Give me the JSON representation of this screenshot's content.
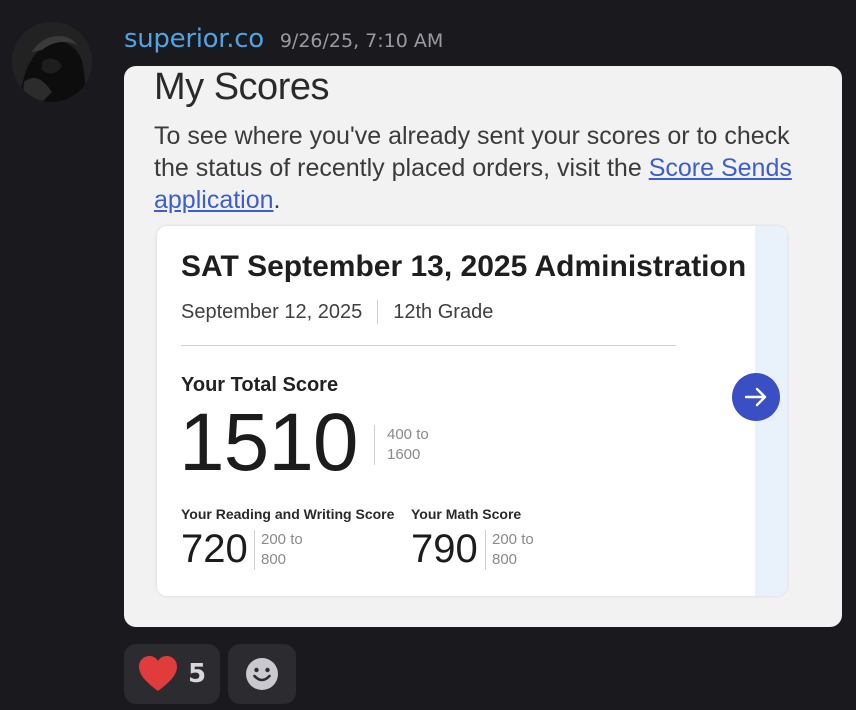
{
  "message": {
    "username": "superior.co",
    "timestamp": "9/26/25, 7:10 AM",
    "avatar_icon": "avatar-dark-figure"
  },
  "attachment": {
    "page_title": "My Scores",
    "intro_text": "To see where you've already sent your scores or to check the status of recently placed orders, visit the ",
    "intro_link": "Score Sends application",
    "intro_end": ".",
    "card": {
      "title": "SAT September 13, 2025 Administration",
      "date": "September 12, 2025",
      "grade": "12th Grade",
      "total_label": "Your Total Score",
      "total_score": "1510",
      "total_range_line1": "400 to",
      "total_range_line2": "1600",
      "rw_label": "Your Reading and Writing Score",
      "rw_score": "720",
      "rw_range_line1": "200 to",
      "rw_range_line2": "800",
      "math_label": "Your Math Score",
      "math_score": "790",
      "math_range_line1": "200 to",
      "math_range_line2": "800",
      "next_icon": "arrow-right-icon",
      "accent_color": "#3b4fc4"
    }
  },
  "reactions": {
    "heart_icon": "heart-icon",
    "heart_count": "5",
    "add_icon": "add-reaction-icon"
  },
  "colors": {
    "background": "#1a1a1e",
    "username": "#4fa3e3",
    "link": "#3b5fd1",
    "heart": "#e03c3c"
  }
}
